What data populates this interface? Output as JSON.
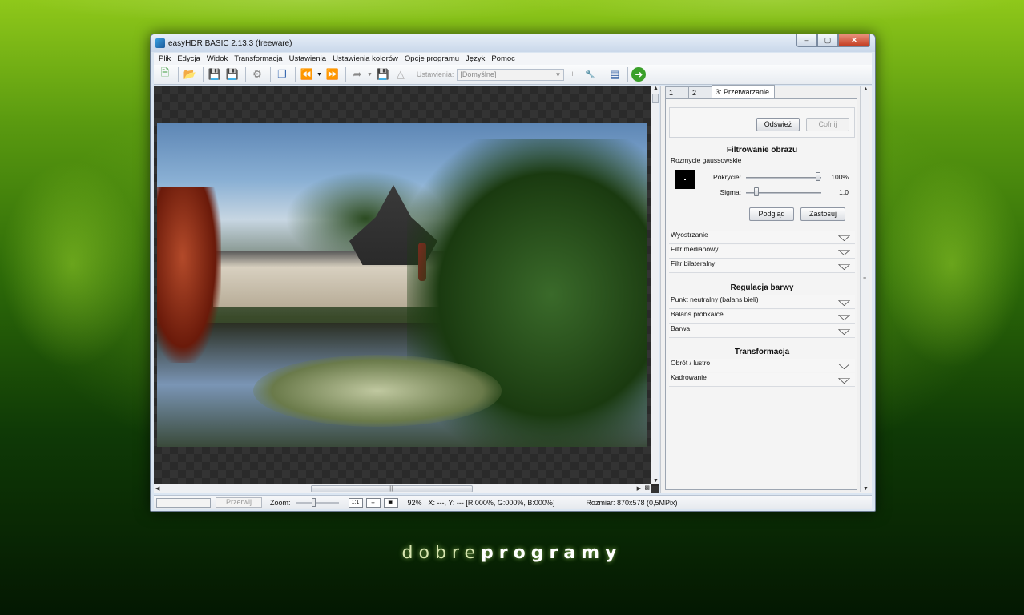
{
  "window": {
    "title": "easyHDR BASIC 2.13.3 (freeware)",
    "controls": {
      "minimize": "–",
      "maximize": "▢",
      "close": "✕"
    }
  },
  "menu": [
    "Plik",
    "Edycja",
    "Widok",
    "Transformacja",
    "Ustawienia",
    "Ustawienia kolorów",
    "Opcje programu",
    "Język",
    "Pomoc"
  ],
  "toolbar": {
    "settings_label": "Ustawienia:",
    "settings_value": "[Domyślne]"
  },
  "tabs": [
    "1",
    "2",
    "3: Przetwarzanie"
  ],
  "panel": {
    "refresh": "Odśwież",
    "undo": "Cofnij",
    "filter_title": "Filtrowanie obrazu",
    "gauss": "Rozmycie gaussowskie",
    "coverage_label": "Pokrycie:",
    "coverage_value": "100%",
    "sigma_label": "Sigma:",
    "sigma_value": "1,0",
    "preview": "Podgląd",
    "apply": "Zastosuj",
    "filter_rows": [
      "Wyostrzanie",
      "Filtr medianowy",
      "Filtr bilateralny"
    ],
    "color_title": "Regulacja barwy",
    "color_rows": [
      "Punkt neutralny (balans bieli)",
      "Balans próbka/cel",
      "Barwa"
    ],
    "transform_title": "Transformacja",
    "transform_rows": [
      "Obrót / lustro",
      "Kadrowanie"
    ]
  },
  "status": {
    "stop": "Przerwij",
    "zoom_label": "Zoom:",
    "zoom_value": "92%",
    "coords": "X: ---, Y: ---  [R:000%, G:000%, B:000%]",
    "size": "Rozmiar: 870x578 (0,5MPix)"
  },
  "brand": {
    "part1": "dobre",
    "part2": "programy"
  }
}
